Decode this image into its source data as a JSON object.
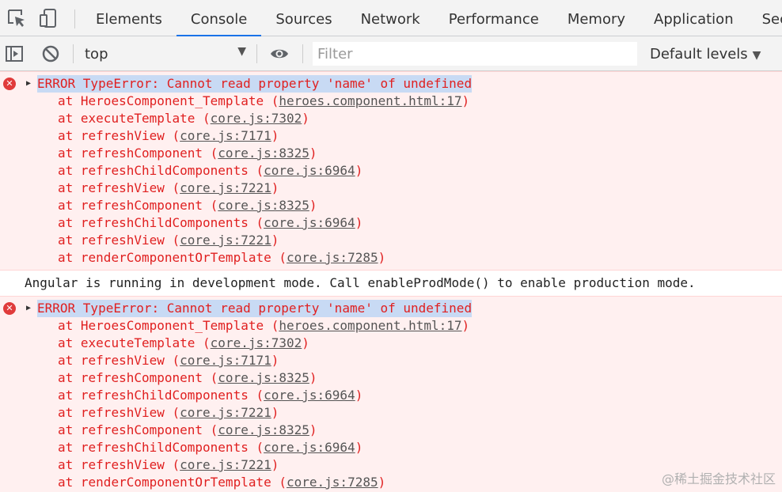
{
  "tabs": [
    "Elements",
    "Console",
    "Sources",
    "Network",
    "Performance",
    "Memory",
    "Application",
    "Securit"
  ],
  "active_tab": "Console",
  "toolbar": {
    "context": "top",
    "filter_placeholder": "Filter",
    "levels": "Default levels"
  },
  "icons": {
    "inspect": "inspect-element-icon",
    "device": "device-toolbar-icon",
    "sidebar": "show-sidebar-icon",
    "clear": "clear-console-icon",
    "eye": "live-expression-icon",
    "error": "error-icon"
  },
  "colors": {
    "error_text": "#e02020",
    "error_bg": "#fff0f0",
    "active_tab_underline": "#1a73e8"
  },
  "messages": [
    {
      "type": "error",
      "text": "ERROR TypeError: Cannot read property 'name' of undefined",
      "frames": [
        {
          "fn": "HeroesComponent_Template",
          "loc": "heroes.component.html:17"
        },
        {
          "fn": "executeTemplate",
          "loc": "core.js:7302"
        },
        {
          "fn": "refreshView",
          "loc": "core.js:7171"
        },
        {
          "fn": "refreshComponent",
          "loc": "core.js:8325"
        },
        {
          "fn": "refreshChildComponents",
          "loc": "core.js:6964"
        },
        {
          "fn": "refreshView",
          "loc": "core.js:7221"
        },
        {
          "fn": "refreshComponent",
          "loc": "core.js:8325"
        },
        {
          "fn": "refreshChildComponents",
          "loc": "core.js:6964"
        },
        {
          "fn": "refreshView",
          "loc": "core.js:7221"
        },
        {
          "fn": "renderComponentOrTemplate",
          "loc": "core.js:7285"
        }
      ]
    },
    {
      "type": "info",
      "text": "Angular is running in development mode. Call enableProdMode() to enable production mode."
    },
    {
      "type": "error",
      "text": "ERROR TypeError: Cannot read property 'name' of undefined",
      "frames": [
        {
          "fn": "HeroesComponent_Template",
          "loc": "heroes.component.html:17"
        },
        {
          "fn": "executeTemplate",
          "loc": "core.js:7302"
        },
        {
          "fn": "refreshView",
          "loc": "core.js:7171"
        },
        {
          "fn": "refreshComponent",
          "loc": "core.js:8325"
        },
        {
          "fn": "refreshChildComponents",
          "loc": "core.js:6964"
        },
        {
          "fn": "refreshView",
          "loc": "core.js:7221"
        },
        {
          "fn": "refreshComponent",
          "loc": "core.js:8325"
        },
        {
          "fn": "refreshChildComponents",
          "loc": "core.js:6964"
        },
        {
          "fn": "refreshView",
          "loc": "core.js:7221"
        },
        {
          "fn": "renderComponentOrTemplate",
          "loc": "core.js:7285"
        }
      ]
    }
  ],
  "watermark": "@稀土掘金技术社区"
}
